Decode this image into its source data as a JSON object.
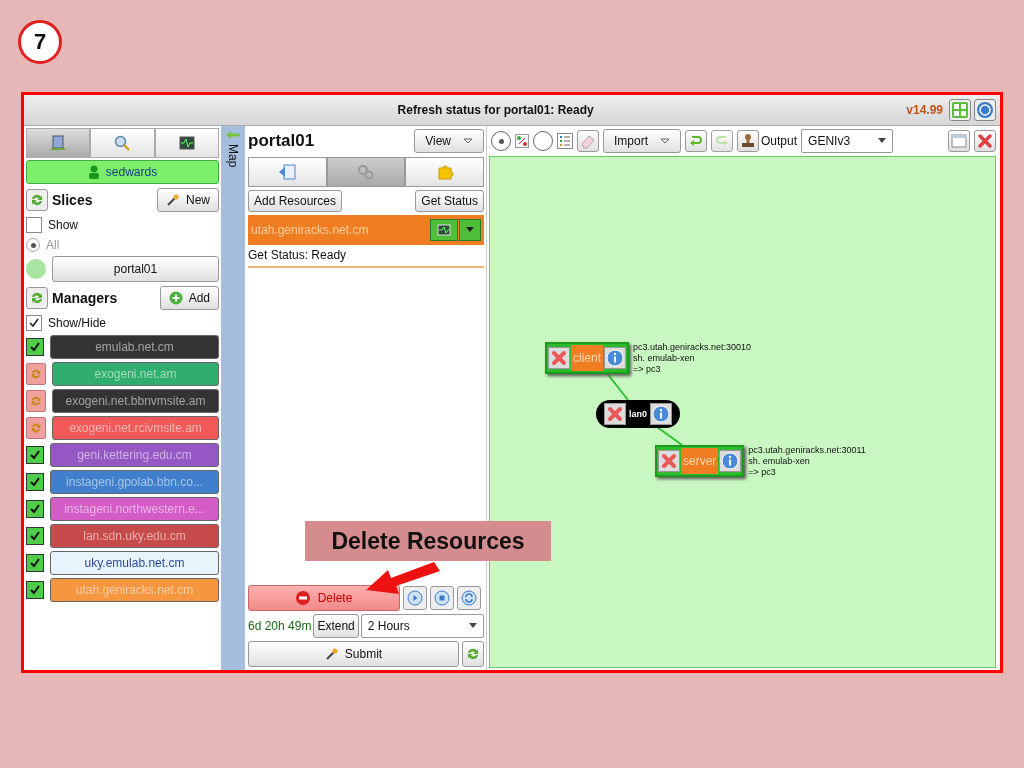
{
  "step": "7",
  "status_bar": {
    "text": "Refresh status for portal01: Ready",
    "version": "v14.99"
  },
  "left_tabs": [
    {
      "selected": true
    },
    {
      "selected": false
    },
    {
      "selected": false
    }
  ],
  "user": "sedwards",
  "slices": {
    "title": "Slices",
    "new_button": "New",
    "show_label": "Show",
    "show_checked": false,
    "all_label": "All",
    "all_selected": true,
    "items": [
      {
        "name": "portal01"
      }
    ]
  },
  "managers": {
    "title": "Managers",
    "add_button": "Add",
    "show_hide_label": "Show/Hide",
    "show_hide_checked": true,
    "items": [
      {
        "name": "emulab.net.cm",
        "kind": "check",
        "color": "#333333"
      },
      {
        "name": "exogeni.net.am",
        "kind": "refresh",
        "color": "#2fae6f"
      },
      {
        "name": "exogeni.net.bbnvmsite.am",
        "kind": "refresh",
        "color": "#333333"
      },
      {
        "name": "exogeni.net.rcivmsite.am",
        "kind": "refresh",
        "color": "#f25a5a"
      },
      {
        "name": "geni.kettering.edu.cm",
        "kind": "check",
        "color": "#9457c4"
      },
      {
        "name": "instageni.gpolab.bbn.co...",
        "kind": "check",
        "color": "#3f7fcc"
      },
      {
        "name": "instageni.northwestern.e...",
        "kind": "check",
        "color": "#d35cc6"
      },
      {
        "name": "lan.sdn.uky.edu.cm",
        "kind": "check",
        "color": "#c84b4b"
      },
      {
        "name": "uky.emulab.net.cm",
        "kind": "check",
        "color": "#e8f4fb"
      },
      {
        "name": "utah.geniracks.net.cm",
        "kind": "check",
        "color": "#f6963f"
      }
    ]
  },
  "map_tab": "Map",
  "slice": {
    "name": "portal01",
    "view_button": "View",
    "tabs": [
      {
        "selected": false
      },
      {
        "selected": true
      },
      {
        "selected": false
      }
    ],
    "add_resources": "Add Resources",
    "get_status": "Get Status",
    "manager_row": "utah.geniracks.net.cm",
    "status_text": "Get Status: Ready",
    "delete_button": "Delete",
    "timer": "6d 20h 49m",
    "extend_button": "Extend",
    "duration": "2 Hours",
    "submit_button": "Submit"
  },
  "toolbar": {
    "view_modes": [
      {
        "selected": true
      },
      {
        "selected": false
      }
    ],
    "import_button": "Import",
    "output_label": "Output",
    "output_value": "GENIv3"
  },
  "canvas": {
    "nodes": [
      {
        "kind": "node",
        "name": "client",
        "details": [
          "pc3.utah.geniracks.net:30010",
          "sh. emulab-xen",
          "=> pc3"
        ]
      },
      {
        "kind": "link",
        "name": "lan0"
      },
      {
        "kind": "node",
        "name": "server",
        "details": [
          "pc3.utah.geniracks.net:30011",
          "sh. emulab-xen",
          "=> pc3"
        ]
      }
    ]
  },
  "callout": "Delete Resources"
}
